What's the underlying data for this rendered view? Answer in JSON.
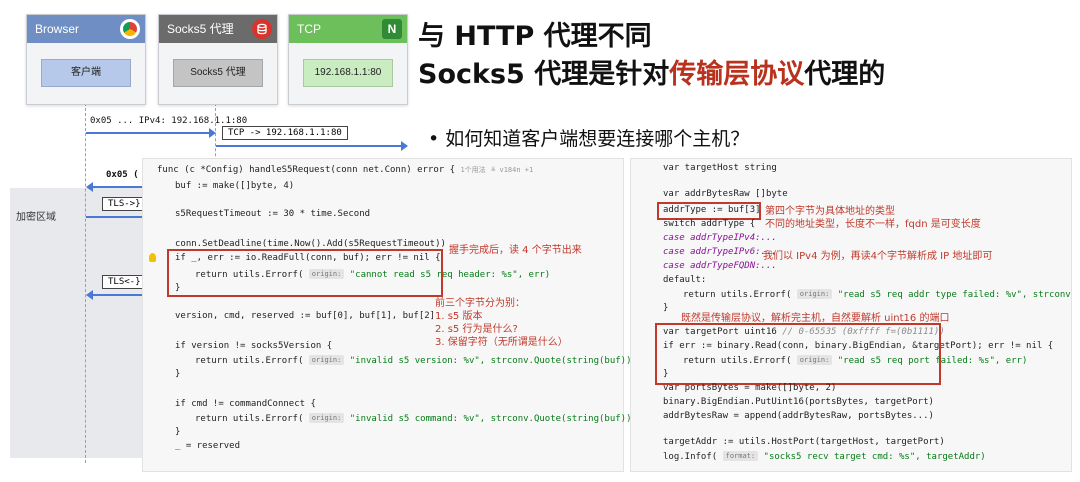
{
  "diagram": {
    "columns": [
      {
        "header": "Browser",
        "inner": "客户端",
        "header_color": "#6f8fc4",
        "inner_color": "#b7c9ea",
        "icon": "chrome-icon"
      },
      {
        "header": "Socks5 代理",
        "inner": "Socks5 代理",
        "header_color": "#6b6b6b",
        "inner_color": "#c4c4c4",
        "icon": "database-icon"
      },
      {
        "header": "TCP",
        "inner": "192.168.1.1:80",
        "header_color": "#6cbf5a",
        "inner_color": "#c9ecc0",
        "icon": "nginx-icon",
        "icon_glyph": "N"
      }
    ],
    "messages": [
      {
        "text": "0x05 ... IPv4: 192.168.1.1:80"
      },
      {
        "text": "TCP -> 192.168.1.1:80"
      },
      {
        "text": "0x05 ("
      },
      {
        "text": "TLS->}"
      },
      {
        "text": "TLS<-}"
      }
    ],
    "region_label": "加密区域"
  },
  "title": {
    "line1": "与 HTTP 代理不同",
    "line2_a": "Socks5 代理是针对",
    "line2_b": "传输层协议",
    "line2_c": "代理的",
    "accent_color": "#b8321e"
  },
  "bullet": "如何知道客户端想要连接哪个主机？",
  "code_left": {
    "usage_hint": "1个用法",
    "author_hint": "≗ v184n +1",
    "lines": {
      "l1_a": "func (c *Config) handleS5Request(conn net.Conn) error {",
      "l2": "buf := make([]byte, 4)",
      "l3": "s5RequestTimeout := 30 * time.Second",
      "l4": "conn.SetDeadline(time.Now().Add(s5RequestTimeout))",
      "l5": "if _, err := io.ReadFull(conn, buf); err != nil {",
      "l6_a": "return utils.Errorf(",
      "l6_hint": "origin:",
      "l6_b": "\"cannot read s5 req header: %s\", err)",
      "l7": "}",
      "l8": "version, cmd, reserved := buf[0], buf[1], buf[2]",
      "l9": "if version != socks5Version {",
      "l10_a": "return utils.Errorf(",
      "l10_hint": "origin:",
      "l10_b": "\"invalid s5 version: %v\", strconv.Quote(string(buf)))",
      "l11": "}",
      "l12": "if cmd != commandConnect {",
      "l13_a": "return utils.Errorf(",
      "l13_hint": "origin:",
      "l13_b": "\"invalid s5 command: %v\", strconv.Quote(string(buf)))",
      "l14": "}",
      "l15": "_ = reserved"
    },
    "annotations": {
      "a1": "握手完成后，读 4 个字节出来",
      "a2_1": "前三个字节分为别：",
      "a2_2": "1. s5 版本",
      "a2_3": "2. s5 行为是什么?",
      "a2_4": "3. 保留字符（无所谓是什么）"
    }
  },
  "code_right": {
    "lines": {
      "r1": "var targetHost string",
      "r2": "var addrBytesRaw []byte",
      "r3": "addrType := buf[3]",
      "r4": "switch addrType {",
      "r5": "case addrTypeIPv4:...",
      "r6": "case addrTypeIPv6:...",
      "r7": "case addrTypeFQDN:...",
      "r8": "default:",
      "r9_a": "return utils.Errorf(",
      "r9_hint": "origin:",
      "r9_b": "\"read s5 req addr type failed: %v\", strconv.Quote(",
      "r10": "}",
      "r11_a": "var targetPort uint16",
      "r11_b": "// 0-65535 (0xffff f=(0b1111))",
      "r12": "if err := binary.Read(conn, binary.BigEndian, &targetPort); err != nil {",
      "r13_a": "return utils.Errorf(",
      "r13_hint": "origin:",
      "r13_b": "\"read s5 req port failed: %s\", err)",
      "r14": "}",
      "r15": "var portsBytes = make([]byte, 2)",
      "r16": "binary.BigEndian.PutUint16(portsBytes, targetPort)",
      "r17": "addrBytesRaw = append(addrBytesRaw, portsBytes...)",
      "r18": "targetAddr := utils.HostPort(targetHost, targetPort)",
      "r19_a": "log.Infof(",
      "r19_hint": "format:",
      "r19_b": "\"socks5 recv target cmd: %s\", targetAddr)"
    },
    "annotations": {
      "b1_1": "第四个字节为具体地址的类型",
      "b1_2": "不同的地址类型，长度不一样，fqdn 是可变长度",
      "b2": "我们以 IPv4 为例，再读4个字节解析成 IP 地址即可",
      "b3": "既然是传输层协议，解析完主机，自然要解析 uint16 的端口"
    }
  }
}
